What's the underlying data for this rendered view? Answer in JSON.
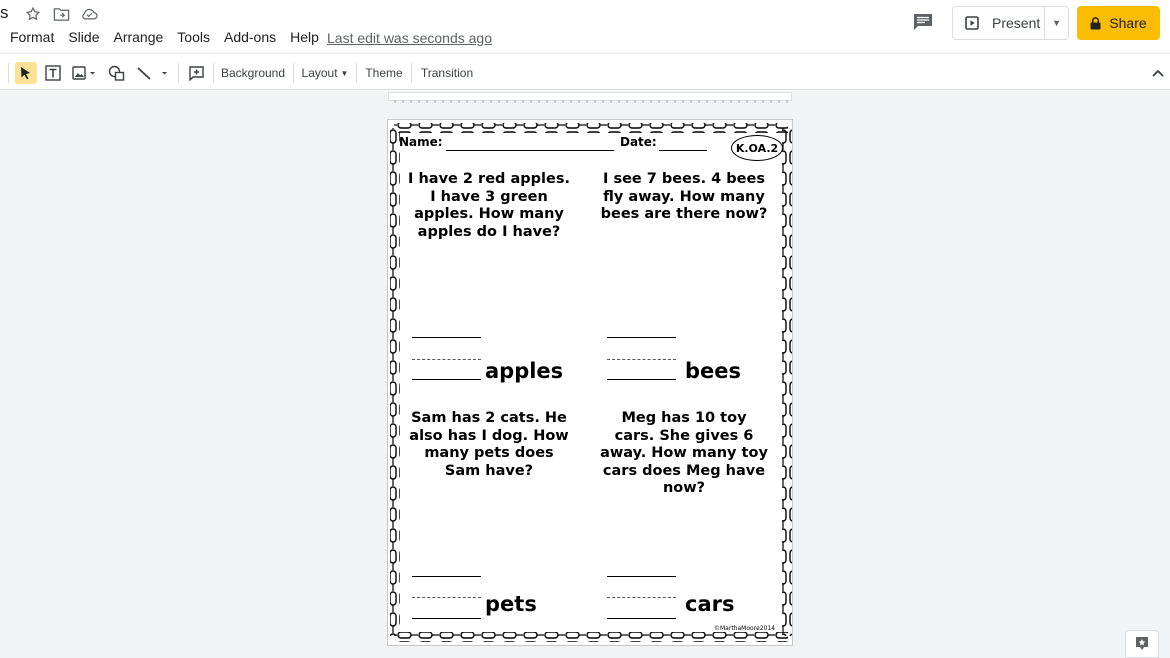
{
  "app": {
    "title_fragment": "s",
    "menus": [
      "Format",
      "Slide",
      "Arrange",
      "Tools",
      "Add-ons",
      "Help"
    ],
    "last_edit": "Last edit was seconds ago",
    "present_label": "Present",
    "share_label": "Share"
  },
  "toolbar": {
    "background_label": "Background",
    "layout_label": "Layout",
    "theme_label": "Theme",
    "transition_label": "Transition"
  },
  "worksheet": {
    "name_label": "Name:",
    "date_label": "Date:",
    "standard_badge": "K.OA.2",
    "problems": [
      {
        "text": "I have 2 red apples. I have 3 green apples. How many apples do I have?",
        "unit": "apples"
      },
      {
        "text": "I see 7 bees. 4 bees fly away. How many bees are there now?",
        "unit": "bees"
      },
      {
        "text": "Sam has 2 cats. He also has I dog. How many pets does Sam have?",
        "unit": "pets"
      },
      {
        "text": "Meg has 10 toy cars. She gives 6 away. How many toy cars does Meg have now?",
        "unit": "cars"
      }
    ],
    "copyright": "©MarthaMoore2014"
  }
}
